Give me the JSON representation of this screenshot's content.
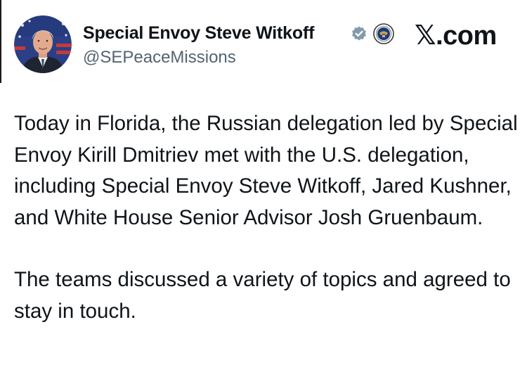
{
  "author": {
    "display_name": "Special Envoy Steve Witkoff",
    "handle": "@SEPeaceMissions"
  },
  "badges": [
    "verified-badge-icon",
    "us-state-department-seal-icon"
  ],
  "watermark": {
    "site": "𝕏.com"
  },
  "tweet": {
    "paragraphs": [
      "Today in Florida, the Russian delegation led by Special Envoy Kirill Dmitriev met with the U.S. delegation, including Special Envoy Steve Witkoff, Jared Kushner, and White House Senior Advisor Josh Gruenbaum.",
      "The teams discussed a variety of topics and agreed to stay in touch."
    ]
  },
  "colors": {
    "text": "#0f1419",
    "handle": "#536471",
    "verified": "#829aab",
    "background": "#ffffff"
  }
}
